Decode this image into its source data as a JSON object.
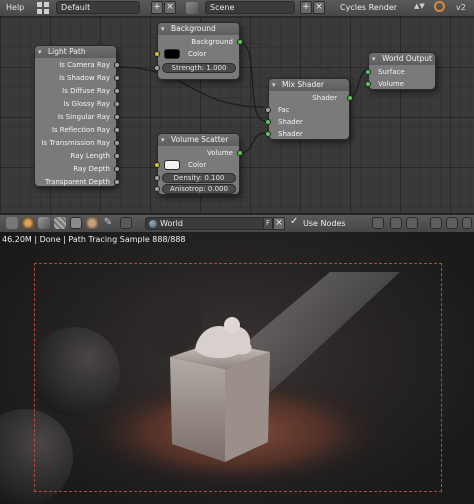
{
  "info_header": {
    "help_label": "Help",
    "screen_layout": "Default",
    "scene": "Scene",
    "render_engine": "Cycles Render",
    "version_fragment": "v2"
  },
  "nodes": {
    "light_path": {
      "title": "Light Path",
      "outputs": [
        "Is Camera Ray",
        "Is Shadow Ray",
        "Is Diffuse Ray",
        "Is Glossy Ray",
        "Is Singular Ray",
        "Is Reflection Ray",
        "Is Transmission Ray",
        "Ray Length",
        "Ray Depth",
        "Transparent Depth"
      ]
    },
    "background": {
      "title": "Background",
      "output_label": "Background",
      "color_label": "Color",
      "color_value": "#000000",
      "strength_label": "Strength:",
      "strength_value": "1.000"
    },
    "mix_shader": {
      "title": "Mix Shader",
      "output_label": "Shader",
      "inputs": [
        "Fac",
        "Shader",
        "Shader"
      ]
    },
    "world_output": {
      "title": "World Output",
      "inputs": [
        "Surface",
        "Volume"
      ]
    },
    "volume_scatter": {
      "title": "Volume Scatter",
      "output_label": "Volume",
      "color_label": "Color",
      "color_value": "#f2f2f2",
      "density_label": "Density:",
      "density_value": "0.100",
      "anisotropy_label": "Anisotrop:",
      "anisotropy_value": "0.000"
    }
  },
  "node_header": {
    "world_name": "World",
    "fake_user_label": "F",
    "use_nodes_label": "Use Nodes"
  },
  "render_view": {
    "status": "46.20M | Done | Path Tracing Sample 888/888"
  },
  "colors": {
    "shader_socket": "#5cc45c",
    "vector_socket": "#6363c7",
    "color_socket": "#c7c729",
    "value_socket": "#a1a1a1",
    "render_border": "#b44a3c"
  }
}
